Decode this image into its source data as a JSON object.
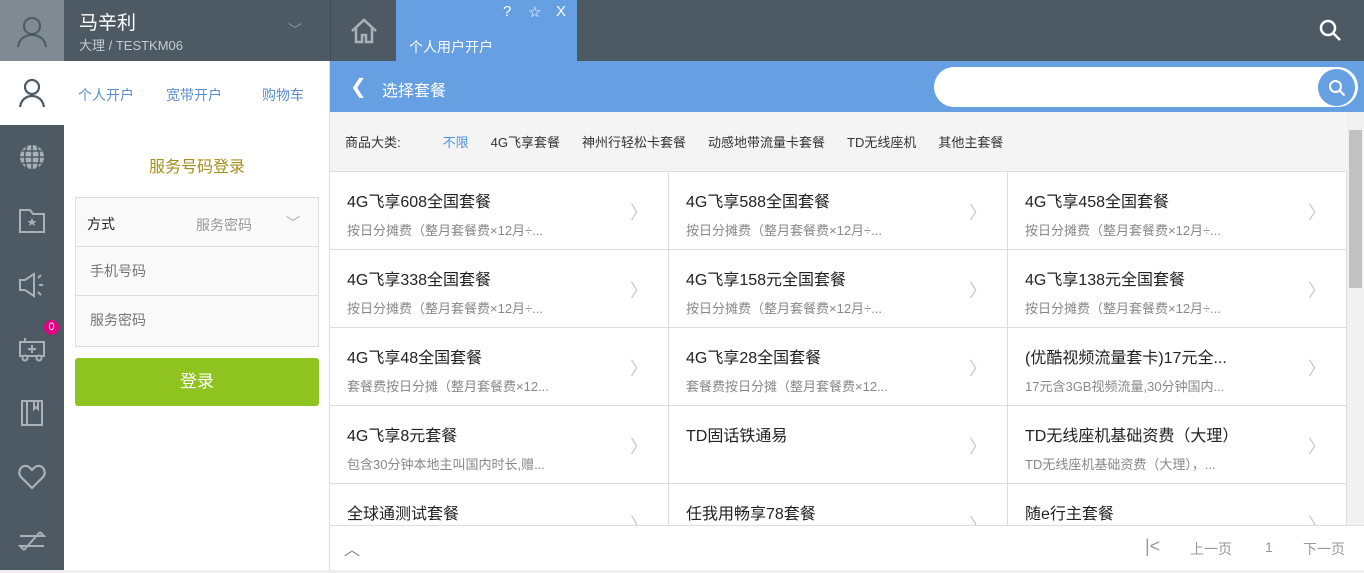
{
  "header": {
    "user_name": "马辛利",
    "user_org": "大理 / TESTKM06",
    "tab_label": "个人用户开户",
    "tab_help": "?",
    "tab_close": "X"
  },
  "panel": {
    "tabs": [
      "个人开户",
      "宽带开户",
      "购物车"
    ],
    "title": "服务号码登录",
    "method_label": "方式",
    "method_value": "服务密码",
    "phone_placeholder": "手机号码",
    "password_placeholder": "服务密码",
    "login_label": "登录",
    "cart_badge": "0"
  },
  "main": {
    "title": "选择套餐",
    "search_placeholder": "",
    "category_label": "商品大类:",
    "categories": [
      "不限",
      "4G飞享套餐",
      "神州行轻松卡套餐",
      "动感地带流量卡套餐",
      "TD无线座机",
      "其他主套餐"
    ],
    "active_category": "不限",
    "items": [
      {
        "name": "4G飞享608全国套餐",
        "desc": "按日分摊费（整月套餐费×12月÷..."
      },
      {
        "name": "4G飞享588全国套餐",
        "desc": "按日分摊费（整月套餐费×12月÷..."
      },
      {
        "name": "4G飞享458全国套餐",
        "desc": "按日分摊费（整月套餐费×12月÷..."
      },
      {
        "name": "4G飞享338全国套餐",
        "desc": "按日分摊费（整月套餐费×12月÷..."
      },
      {
        "name": "4G飞享158元全国套餐",
        "desc": "按日分摊费（整月套餐费×12月÷..."
      },
      {
        "name": "4G飞享138元全国套餐",
        "desc": "按日分摊费（整月套餐费×12月÷..."
      },
      {
        "name": "4G飞享48全国套餐",
        "desc": "套餐费按日分摊（整月套餐费×12..."
      },
      {
        "name": "4G飞享28全国套餐",
        "desc": "套餐费按日分摊（整月套餐费×12..."
      },
      {
        "name": "(优酷视频流量套卡)17元全...",
        "desc": "17元含3GB视频流量,30分钟国内..."
      },
      {
        "name": "4G飞享8元套餐",
        "desc": "包含30分钟本地主叫国内时长,赠..."
      },
      {
        "name": "TD固话铁通易",
        "desc": ""
      },
      {
        "name": "TD无线座机基础资费（大理）",
        "desc": "TD无线座机基础资费（大理），..."
      },
      {
        "name": "全球通测试套餐",
        "desc": ""
      },
      {
        "name": "任我用畅享78套餐",
        "desc": ""
      },
      {
        "name": "随e行主套餐",
        "desc": ""
      }
    ]
  },
  "pagination": {
    "prev": "上一页",
    "page": "1",
    "next": "下一页"
  },
  "colors": {
    "accent": "#66a0e2",
    "header": "#4d5a64",
    "login": "#8fc31f",
    "title": "#a58f1d",
    "badge": "#e4007f"
  }
}
